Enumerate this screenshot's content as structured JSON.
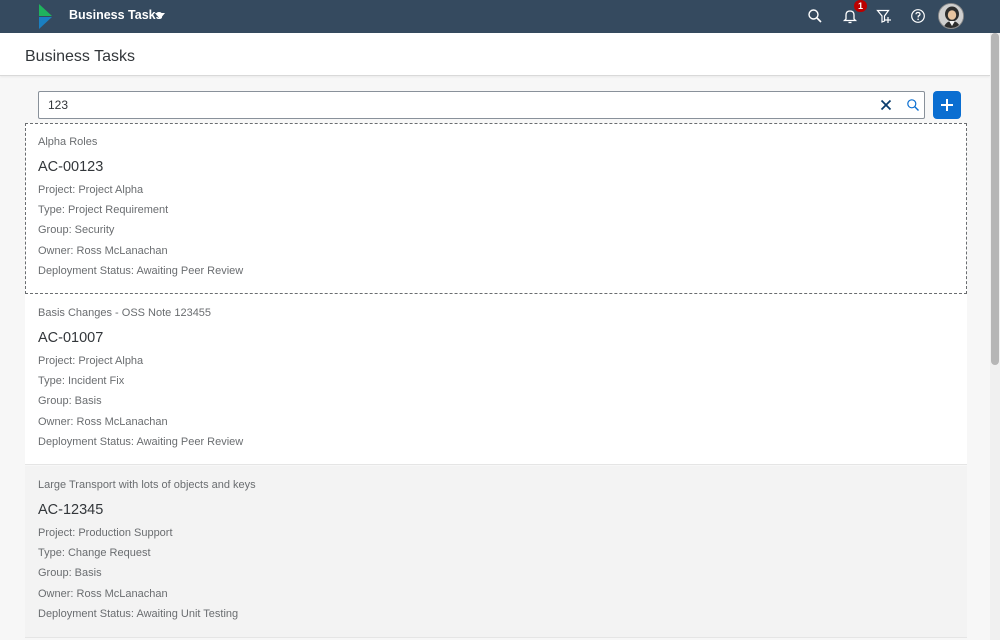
{
  "shellbar": {
    "app_title": "Business Tasks",
    "notification_count": "1",
    "icons": [
      "logo-icon",
      "chevron-down-icon",
      "search-icon",
      "bell-icon",
      "filter-add-icon",
      "help-icon",
      "avatar"
    ]
  },
  "page": {
    "title": "Business Tasks"
  },
  "search": {
    "value": "123",
    "placeholder": ""
  },
  "colors": {
    "shellbar": "#354a5f",
    "accent": "#0a6ed1",
    "badge": "#bb0000",
    "logo_green": "#1fb35d",
    "logo_blue": "#1a7fc1"
  },
  "tasks": [
    {
      "description": "Alpha Roles",
      "id": "AC-00123",
      "project": "Project: Project Alpha",
      "type": "Type: Project Requirement",
      "group": "Group: Security",
      "owner": "Owner: Ross McLanachan",
      "status": "Deployment Status: Awaiting Peer Review"
    },
    {
      "description": "Basis Changes - OSS Note 123455",
      "id": "AC-01007",
      "project": "Project: Project Alpha",
      "type": "Type: Incident Fix",
      "group": "Group: Basis",
      "owner": "Owner: Ross McLanachan",
      "status": "Deployment Status: Awaiting Peer Review"
    },
    {
      "description": "Large Transport with lots of objects and keys",
      "id": "AC-12345",
      "project": "Project: Production Support",
      "type": "Type: Change Request",
      "group": "Group: Basis",
      "owner": "Owner: Ross McLanachan",
      "status": "Deployment Status: Awaiting Unit Testing"
    }
  ]
}
